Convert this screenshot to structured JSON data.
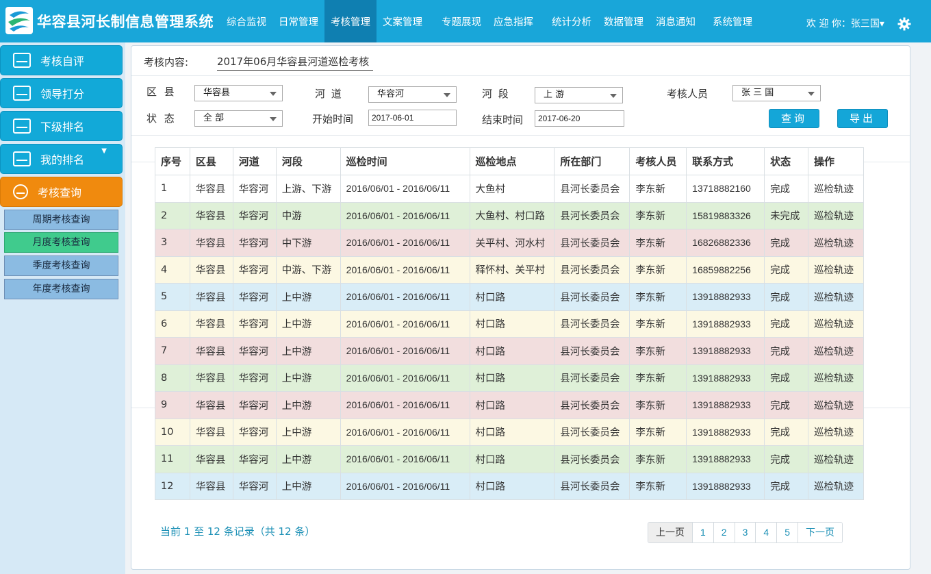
{
  "header": {
    "app_title": "华容县河长制信息管理系统",
    "nav": [
      "综合监视",
      "日常管理",
      "考核管理",
      "文案管理",
      "专题展现",
      "应急指挥",
      "统计分析",
      "数据管理",
      "消息通知",
      "系统管理"
    ],
    "active_nav": "考核管理",
    "welcome": "欢 迎 你：张三国",
    "user_caret": "▾"
  },
  "sidebar": {
    "items": [
      {
        "label": "考核自评",
        "icon": "monitor-icon"
      },
      {
        "label": "领导打分",
        "icon": "chart-icon"
      },
      {
        "label": "下级排名",
        "icon": "ranking-icon"
      },
      {
        "label": "我的排名",
        "icon": "book-icon"
      },
      {
        "label": "考核查询",
        "icon": "disc-icon"
      }
    ],
    "sub_items": [
      "周期考核查询",
      "月度考核查询",
      "季度考核查询",
      "年度考核查询"
    ],
    "active_sub": "月度考核查询",
    "expand_caret": "▼"
  },
  "form": {
    "content_label": "考核内容:",
    "content_value": "2017年06月华容县河道巡检考核",
    "county_label": "区  县",
    "county_value": "华容县",
    "river_label": "河   道",
    "river_value": "华容河",
    "segment_label": "河   段",
    "segment_value": "上 游",
    "inspector_label": "考核人员",
    "inspector_value": "张 三 国",
    "status_label": "状  态",
    "status_value": "全 部",
    "start_label": "开始时间",
    "start_value": "2017-06-01",
    "end_label": "结束时间",
    "end_value": "2017-06-20",
    "query_btn": "查询",
    "export_btn": "导出"
  },
  "table": {
    "headers": [
      "序号",
      "区县",
      "河道",
      "河段",
      "巡检时间",
      "巡检地点",
      "所在部门",
      "考核人员",
      "联系方式",
      "状态",
      "操作"
    ],
    "rows": [
      {
        "no": "1",
        "county": "华容县",
        "river": "华容河",
        "segment": "上游、下游",
        "time": "2016/06/01 - 2016/06/11",
        "place": "大鱼村",
        "dept": "县河长委员会",
        "person": "李东新",
        "phone": "13718882160",
        "status": "完成",
        "action": "巡检轨迹",
        "color": "c-white"
      },
      {
        "no": "2",
        "county": "华容县",
        "river": "华容河",
        "segment": "中游",
        "time": "2016/06/01 - 2016/06/11",
        "place": "大鱼村、村口路",
        "dept": "县河长委员会",
        "person": "李东新",
        "phone": "15819883326",
        "status": "未完成",
        "action": "巡检轨迹",
        "color": "c-green"
      },
      {
        "no": "3",
        "county": "华容县",
        "river": "华容河",
        "segment": "中下游",
        "time": "2016/06/01 - 2016/06/11",
        "place": "关平村、河水村",
        "dept": "县河长委员会",
        "person": "李东新",
        "phone": "16826882336",
        "status": "完成",
        "action": "巡检轨迹",
        "color": "c-pink"
      },
      {
        "no": "4",
        "county": "华容县",
        "river": "华容河",
        "segment": "中游、下游",
        "time": "2016/06/01 - 2016/06/11",
        "place": "释怀村、关平村",
        "dept": "县河长委员会",
        "person": "李东新",
        "phone": "16859882256",
        "status": "完成",
        "action": "巡检轨迹",
        "color": "c-yellow"
      },
      {
        "no": "5",
        "county": "华容县",
        "river": "华容河",
        "segment": "上中游",
        "time": "2016/06/01 - 2016/06/11",
        "place": "村口路",
        "dept": "县河长委员会",
        "person": "李东新",
        "phone": "13918882933",
        "status": "完成",
        "action": "巡检轨迹",
        "color": "c-blue"
      },
      {
        "no": "6",
        "county": "华容县",
        "river": "华容河",
        "segment": "上中游",
        "time": "2016/06/01 - 2016/06/11",
        "place": "村口路",
        "dept": "县河长委员会",
        "person": "李东新",
        "phone": "13918882933",
        "status": "完成",
        "action": "巡检轨迹",
        "color": "c-yellow"
      },
      {
        "no": "7",
        "county": "华容县",
        "river": "华容河",
        "segment": "上中游",
        "time": "2016/06/01 - 2016/06/11",
        "place": "村口路",
        "dept": "县河长委员会",
        "person": "李东新",
        "phone": "13918882933",
        "status": "完成",
        "action": "巡检轨迹",
        "color": "c-pink"
      },
      {
        "no": "8",
        "county": "华容县",
        "river": "华容河",
        "segment": "上中游",
        "time": "2016/06/01 - 2016/06/11",
        "place": "村口路",
        "dept": "县河长委员会",
        "person": "李东新",
        "phone": "13918882933",
        "status": "完成",
        "action": "巡检轨迹",
        "color": "c-green"
      },
      {
        "no": "9",
        "county": "华容县",
        "river": "华容河",
        "segment": "上中游",
        "time": "2016/06/01 - 2016/06/11",
        "place": "村口路",
        "dept": "县河长委员会",
        "person": "李东新",
        "phone": "13918882933",
        "status": "完成",
        "action": "巡检轨迹",
        "color": "c-pink"
      },
      {
        "no": "10",
        "county": "华容县",
        "river": "华容河",
        "segment": "上中游",
        "time": "2016/06/01 - 2016/06/11",
        "place": "村口路",
        "dept": "县河长委员会",
        "person": "李东新",
        "phone": "13918882933",
        "status": "完成",
        "action": "巡检轨迹",
        "color": "c-yellow"
      },
      {
        "no": "11",
        "county": "华容县",
        "river": "华容河",
        "segment": "上中游",
        "time": "2016/06/01 - 2016/06/11",
        "place": "村口路",
        "dept": "县河长委员会",
        "person": "李东新",
        "phone": "13918882933",
        "status": "完成",
        "action": "巡检轨迹",
        "color": "c-green"
      },
      {
        "no": "12",
        "county": "华容县",
        "river": "华容河",
        "segment": "上中游",
        "time": "2016/06/01 - 2016/06/11",
        "place": "村口路",
        "dept": "县河长委员会",
        "person": "李东新",
        "phone": "13918882933",
        "status": "完成",
        "action": "巡检轨迹",
        "color": "c-blue"
      }
    ]
  },
  "footer": {
    "records_text": "当前 1 至 12 条记录（共 12 条）",
    "prev": "上一页",
    "pages": [
      "1",
      "2",
      "3",
      "4",
      "5"
    ],
    "next": "下一页"
  },
  "colors": {
    "topbar": "#19a6d9",
    "active_nav": "#0f7fb1",
    "menu": "#12a9d8",
    "menu_active": "#f08a0e",
    "sub_active": "#40cb8d"
  }
}
